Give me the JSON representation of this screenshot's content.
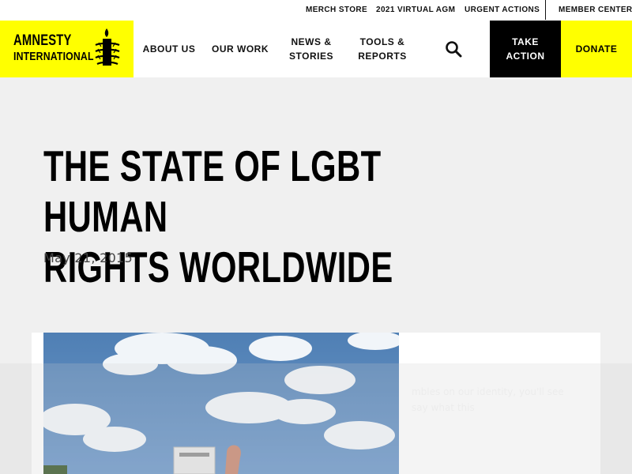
{
  "utility_nav": {
    "links": [
      "MERCH STORE",
      "2021 VIRTUAL AGM",
      "URGENT ACTIONS"
    ],
    "member_center": "MEMBER CENTER"
  },
  "logo": {
    "line1": "AMNESTY",
    "line2": "INTERNATIONAL",
    "icon": "candle-barbed-wire-icon"
  },
  "main_nav": {
    "items": [
      "ABOUT US",
      "OUR WORK",
      "NEWS &\nSTORIES",
      "TOOLS &\nREPORTS"
    ],
    "search_icon": "search-icon",
    "take_action": "TAKE\nACTION",
    "donate": "DONATE"
  },
  "article": {
    "title": "THE STATE OF LGBT HUMAN\nRIGHTS WORLDWIDE",
    "date": "May 21, 2015",
    "image_caption_fragment": "mbles on our identity, you'll see\nsay what this"
  },
  "colors": {
    "brand_yellow": "#ffff00",
    "black": "#000000",
    "page_background": "#f0f0f0"
  }
}
